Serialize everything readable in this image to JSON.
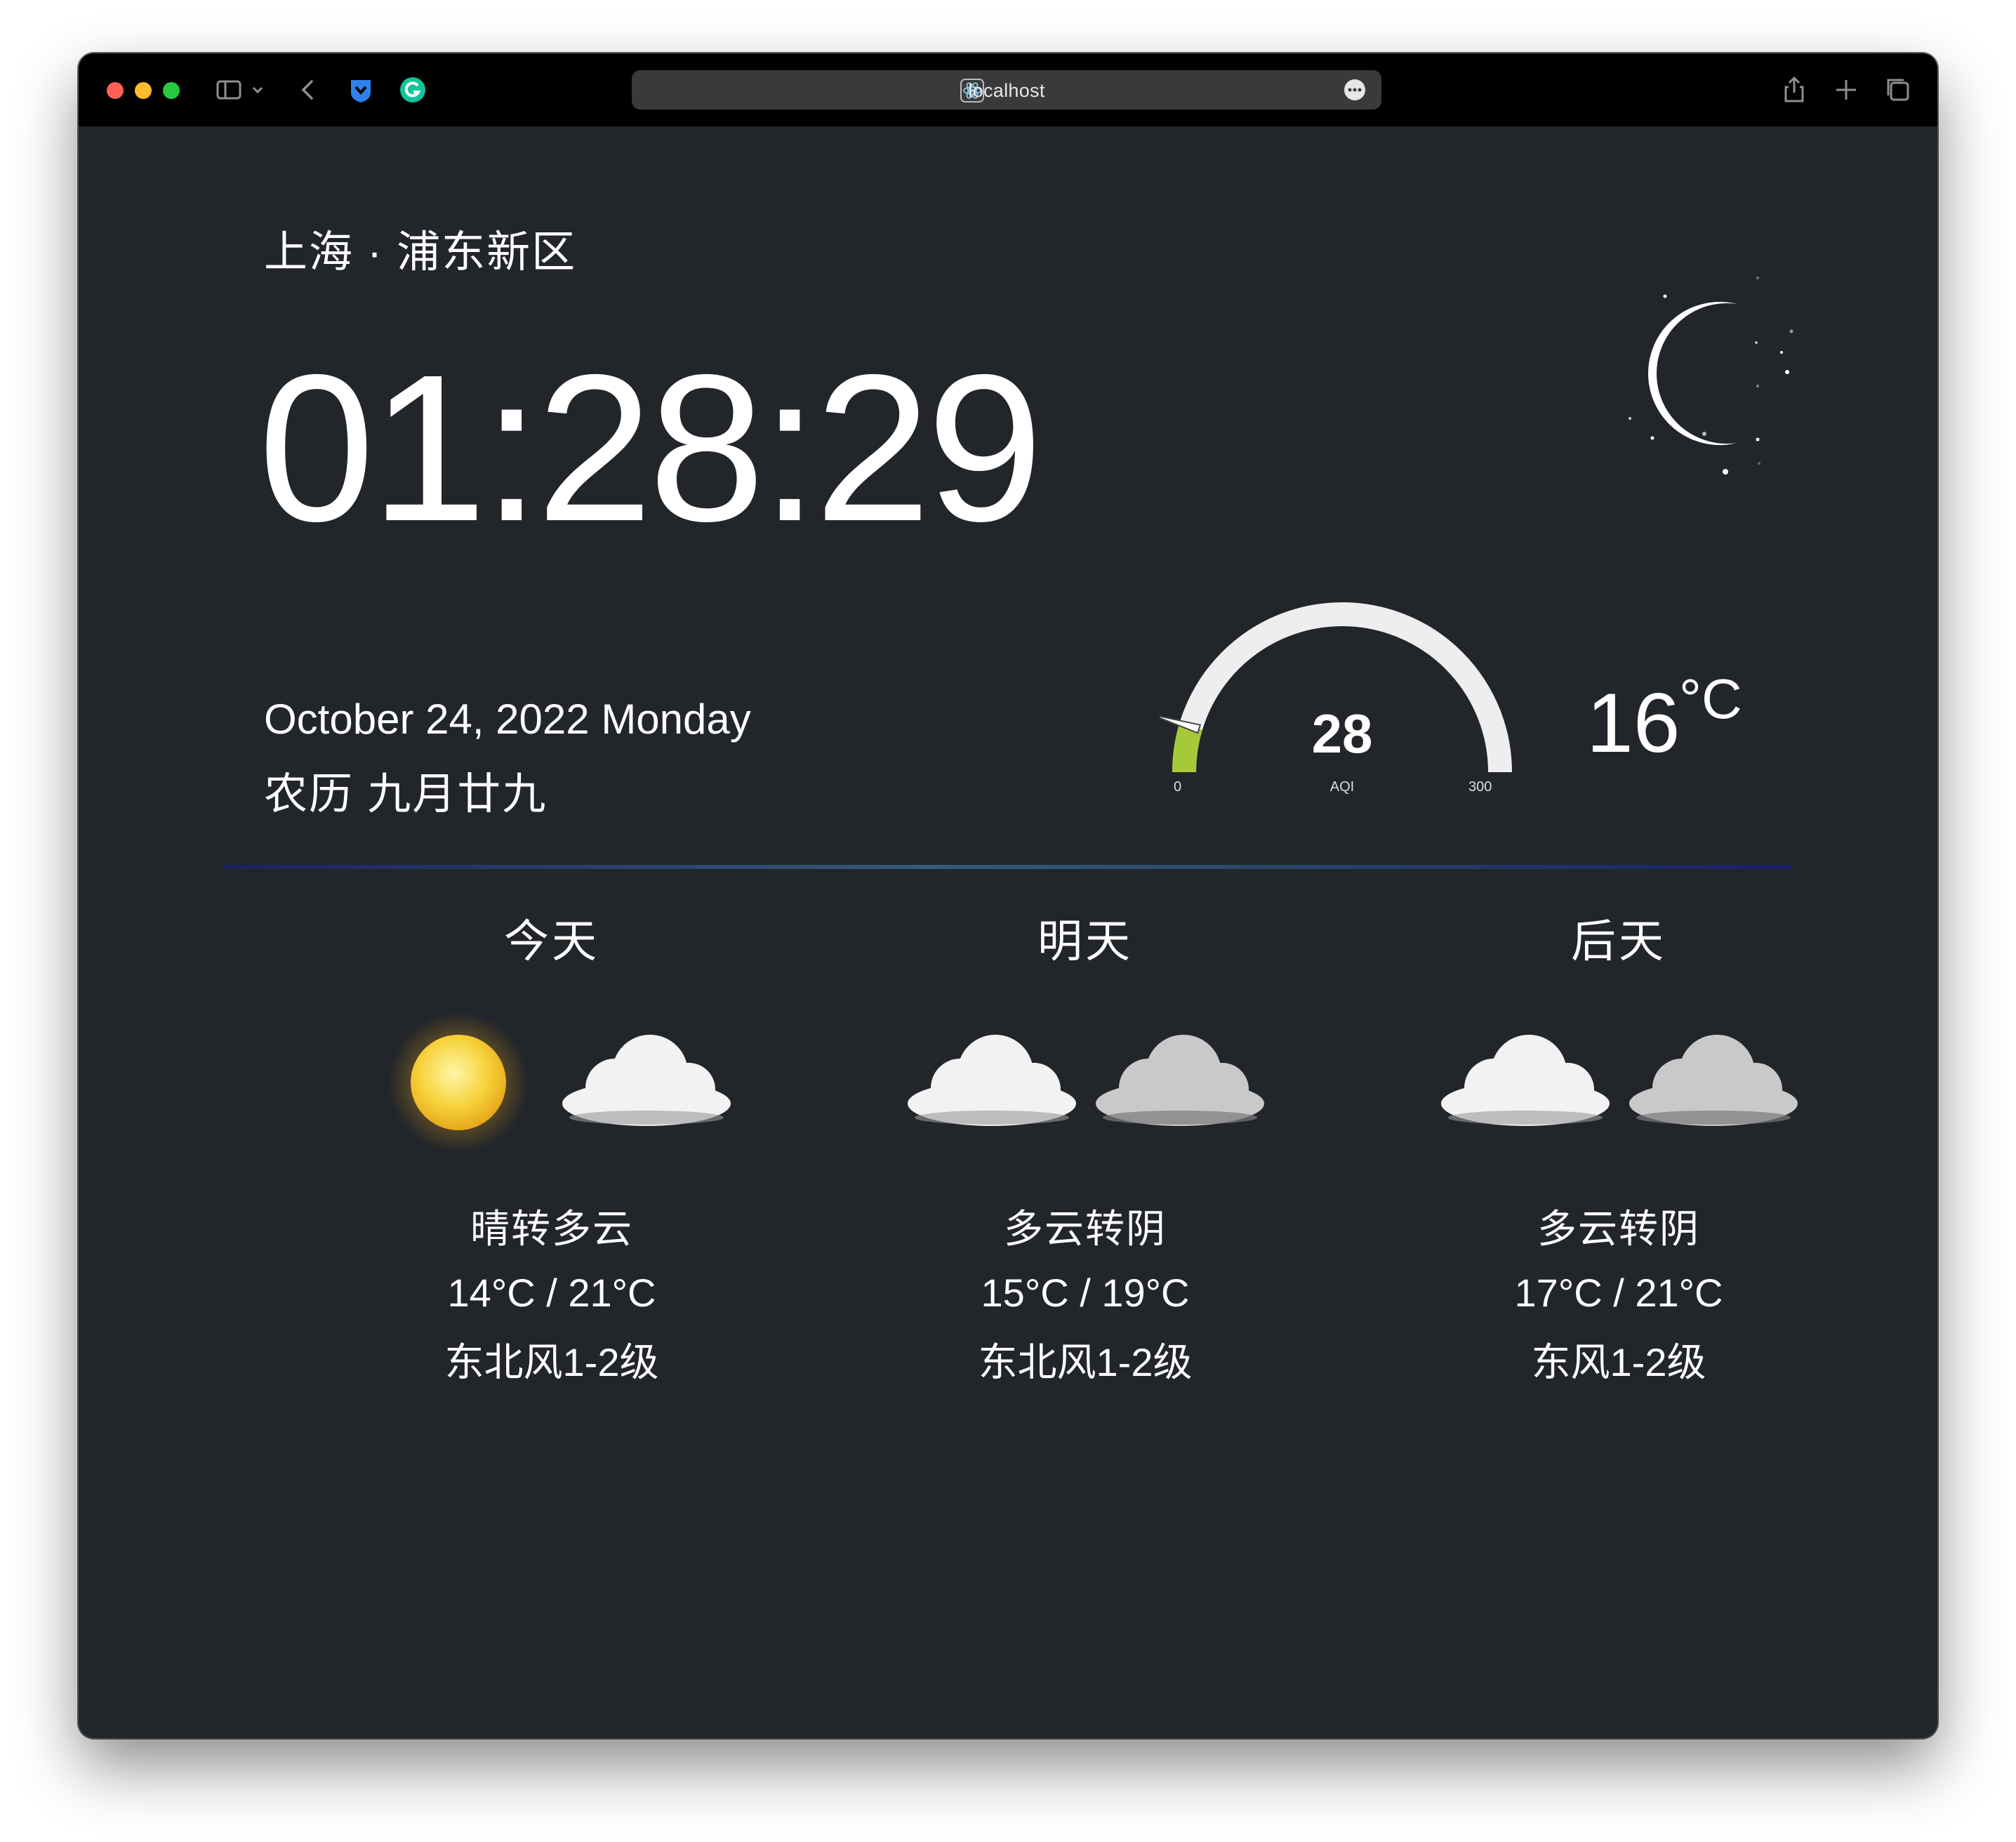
{
  "browser": {
    "url": "localhost",
    "traffic_lights": {
      "close": "#ff5f57",
      "minimize": "#febc2e",
      "zoom": "#28c840"
    },
    "icons": [
      "sidebar-toggle-icon",
      "chevron-down-icon",
      "back-icon",
      "shield-extension-icon",
      "grammarly-icon",
      "react-favicon-icon",
      "more-icon",
      "share-icon",
      "new-tab-icon",
      "tab-overview-icon"
    ]
  },
  "header": {
    "location": "上海 · 浦东新区",
    "time": "01:28:29",
    "date": "October 24, 2022 Monday",
    "lunar": "农历 九月廿九"
  },
  "aqi": {
    "value": "28",
    "label": "AQI",
    "min": "0",
    "max": "300",
    "level": 28,
    "colors": {
      "track": "#eeeeee",
      "fill": "#a6c93a"
    }
  },
  "current": {
    "temp": "16",
    "unit": "°C",
    "sky_icon": "moon-icon"
  },
  "forecast": [
    {
      "day": "今天",
      "icons": [
        "sun-icon",
        "cloud-icon"
      ],
      "condition": "晴转多云",
      "range": "14°C / 21°C",
      "wind": "东北风1-2级"
    },
    {
      "day": "明天",
      "icons": [
        "cloud-icon",
        "overcast-cloud-icon"
      ],
      "condition": "多云转阴",
      "range": "15°C / 19°C",
      "wind": "东北风1-2级"
    },
    {
      "day": "后天",
      "icons": [
        "cloud-icon",
        "overcast-cloud-icon"
      ],
      "condition": "多云转阴",
      "range": "17°C / 21°C",
      "wind": "东风1-2级"
    }
  ]
}
